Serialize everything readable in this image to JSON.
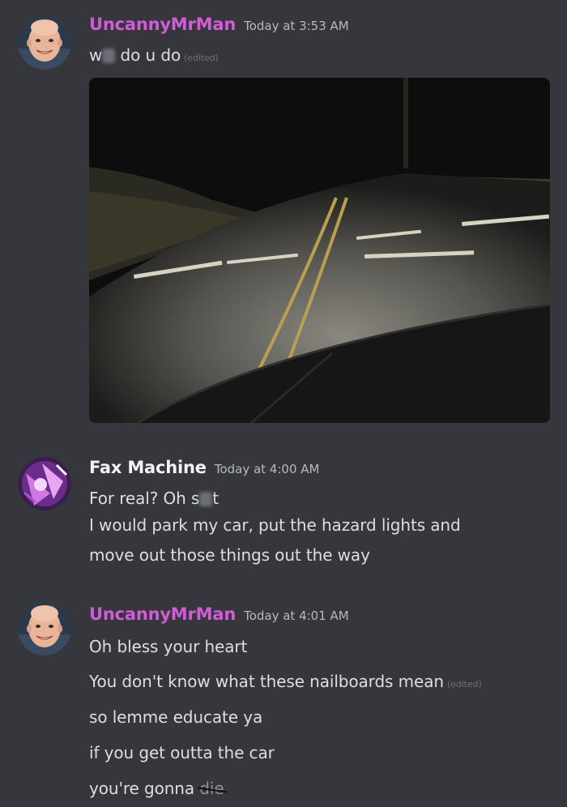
{
  "messages": [
    {
      "username": "UncannyMrMan",
      "timestamp": "Today at 3:53 AM",
      "lines": [
        {
          "pre": "w",
          "post": "do u do",
          "edited": "(edited)"
        }
      ],
      "image_alt": "road with nailboards at night"
    },
    {
      "username": "Fax Machine",
      "timestamp": "Today at 4:00 AM",
      "lines": [
        {
          "pre": "For real? Oh s",
          "post": "t"
        },
        {
          "text": "I would park my car, put the hazard lights and"
        },
        {
          "text": "move out those things out the way"
        }
      ]
    },
    {
      "username": "UncannyMrMan",
      "timestamp": "Today at 4:01 AM",
      "lines": [
        {
          "text": "Oh bless your heart"
        },
        {
          "text": "You don't know what these nailboards mean",
          "edited": "(edited)"
        },
        {
          "text": "so lemme educate ya"
        },
        {
          "text": "if you get outta the car"
        },
        {
          "pre": "you're gonna ",
          "struck": "die"
        }
      ]
    }
  ],
  "colors": {
    "background": "#35373c",
    "username_uncanny": "#d35bd8",
    "username_fax": "#f2f3f5",
    "timestamp": "#b5bac1",
    "text": "#dcdee2"
  },
  "icons": {
    "avatar_uncanny": "bald-man-face-avatar",
    "avatar_fax": "purple-anime-avatar"
  }
}
